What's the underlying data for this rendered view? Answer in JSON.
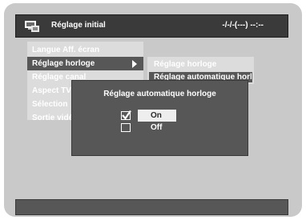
{
  "header": {
    "icon": "dvd-recorder-icon",
    "title": "Réglage initial",
    "clock": "-/-/-(---)   --:--"
  },
  "menu": {
    "items": [
      {
        "label": "Langue Aff. écran"
      },
      {
        "label": "Réglage horloge"
      },
      {
        "label": "Réglage canal"
      },
      {
        "label": "Aspect TV"
      },
      {
        "label": "Sélection"
      },
      {
        "label": "Sortie vidéo"
      }
    ],
    "active_index": 1
  },
  "submenu": {
    "title": "Réglage horloge",
    "selected": "Réglage automatique horloge"
  },
  "dialog": {
    "title": "Réglage automatique horloge",
    "options": [
      {
        "label": "On",
        "checked": true
      },
      {
        "label": "Off",
        "checked": false
      }
    ]
  },
  "colors": {
    "screen_bg": "#c9c9c9",
    "panel_dark": "#575757",
    "header_bg": "#3a3a3a",
    "menu_bg": "#dcdcdc",
    "highlight": "#eeeeee"
  }
}
